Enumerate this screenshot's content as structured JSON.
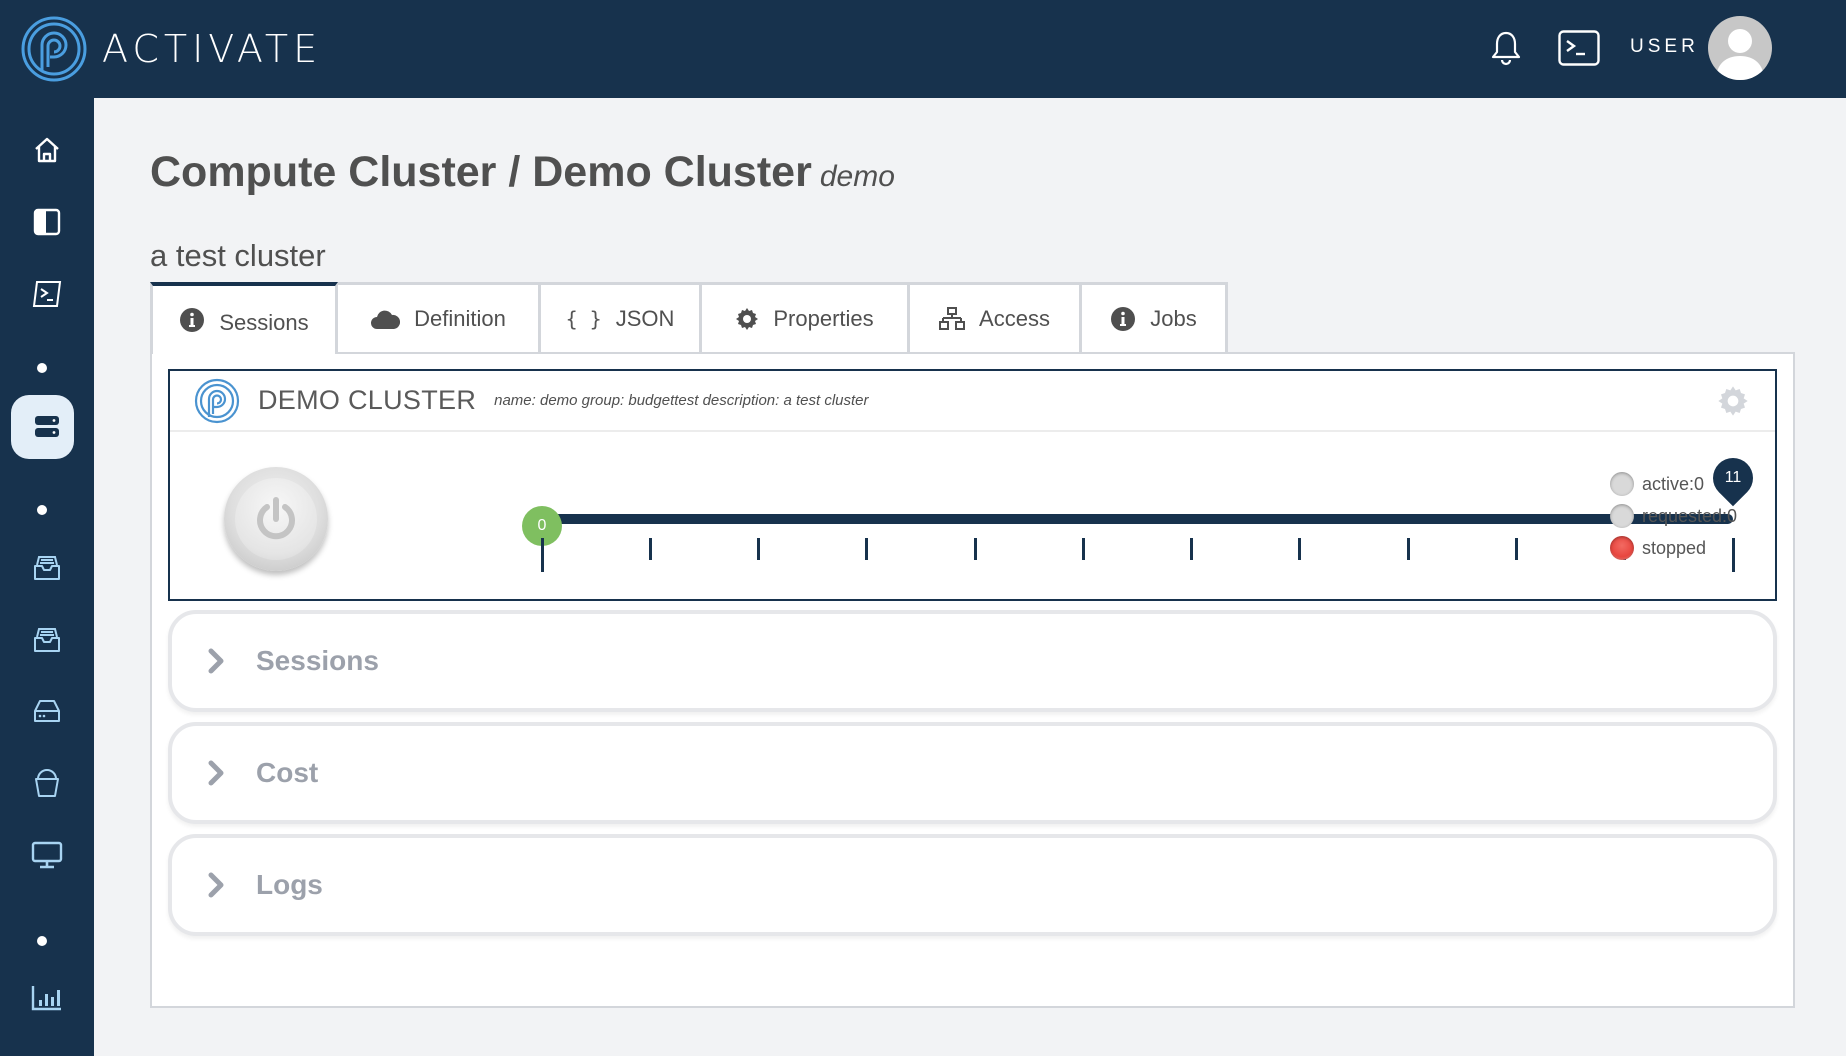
{
  "header": {
    "brand": "ACTIVATE",
    "user_label": "USER",
    "icons": [
      "logo-icon",
      "bell-icon",
      "terminal-icon",
      "user-avatar"
    ]
  },
  "sidebar": {
    "items": [
      {
        "name": "home",
        "icon": "home-icon"
      },
      {
        "name": "sidebar-panel",
        "icon": "sidebar-toggle-icon"
      },
      {
        "name": "terminal",
        "icon": "terminal-icon"
      },
      {
        "name": "compute",
        "icon": "server-icon",
        "active": true
      },
      {
        "name": "storage-1",
        "icon": "inbox-tray-icon"
      },
      {
        "name": "storage-2",
        "icon": "inbox-tray-icon"
      },
      {
        "name": "disk",
        "icon": "hard-drive-icon"
      },
      {
        "name": "bucket",
        "icon": "bucket-icon"
      },
      {
        "name": "desktop",
        "icon": "monitor-icon"
      },
      {
        "name": "reports",
        "icon": "bar-chart-icon"
      }
    ]
  },
  "page": {
    "title": "Compute Cluster / Demo Cluster",
    "subtitle": "demo",
    "description": "a test cluster"
  },
  "tabs": [
    {
      "label": "Sessions",
      "icon": "info-icon",
      "active": true
    },
    {
      "label": "Definition",
      "icon": "cloud-icon"
    },
    {
      "label": "JSON",
      "icon": "braces-icon"
    },
    {
      "label": "Properties",
      "icon": "gear-icon"
    },
    {
      "label": "Access",
      "icon": "network-icon"
    },
    {
      "label": "Jobs",
      "icon": "info-icon"
    }
  ],
  "cluster_card": {
    "title": "DEMO CLUSTER",
    "meta": "name: demo group: budgettest description: a test cluster",
    "slider": {
      "min": 0,
      "max": 11,
      "min_value": 0,
      "max_value": 11,
      "min_label": "0",
      "max_label": "11",
      "tick_count": 12
    },
    "status_legend": [
      {
        "label": "active:0",
        "color": "#d9d9d9"
      },
      {
        "label": "requested:0",
        "color": "#d9d9d9"
      },
      {
        "label": "stopped",
        "color": "#e8463f"
      }
    ],
    "colors": {
      "slider": "#17324d",
      "min_handle": "#7fbf60"
    }
  },
  "accordions": [
    {
      "label": "Sessions"
    },
    {
      "label": "Cost"
    },
    {
      "label": "Logs"
    }
  ]
}
